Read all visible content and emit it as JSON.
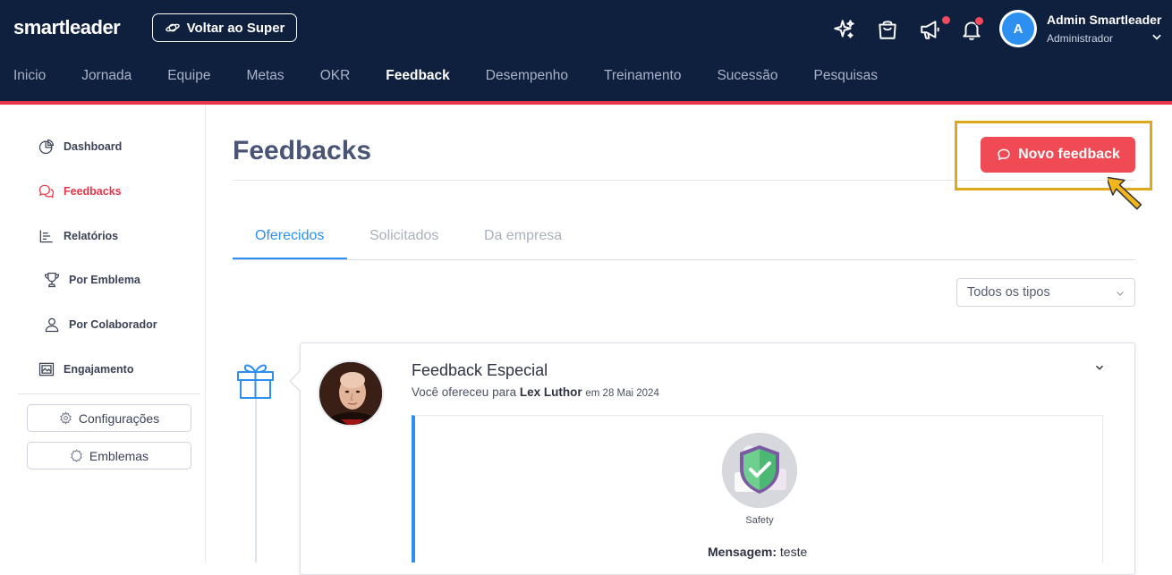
{
  "header": {
    "logo": "smartleader",
    "back_button": "Voltar ao Super",
    "user_initial": "A",
    "user_name": "Admin Smartleader",
    "user_role": "Administrador"
  },
  "nav": [
    "Inicio",
    "Jornada",
    "Equipe",
    "Metas",
    "OKR",
    "Feedback",
    "Desempenho",
    "Treinamento",
    "Sucessão",
    "Pesquisas"
  ],
  "nav_active": "Feedback",
  "sidebar": {
    "items": [
      {
        "label": "Dashboard",
        "icon": "pie-chart-icon"
      },
      {
        "label": "Feedbacks",
        "icon": "chat-bubbles-icon",
        "active": true
      },
      {
        "label": "Relatórios",
        "icon": "bar-list-icon"
      },
      {
        "label": "Por Emblema",
        "icon": "trophy-icon"
      },
      {
        "label": "Por Colaborador",
        "icon": "user-icon"
      },
      {
        "label": "Engajamento",
        "icon": "image-frame-icon"
      }
    ],
    "buttons": [
      {
        "label": "Configurações",
        "icon": "gear-icon"
      },
      {
        "label": "Emblemas",
        "icon": "badge-icon"
      }
    ]
  },
  "page": {
    "title": "Feedbacks",
    "new_button": "Novo feedback",
    "tabs": [
      "Oferecidos",
      "Solicitados",
      "Da empresa"
    ],
    "active_tab": "Oferecidos",
    "filter_value": "Todos os tipos"
  },
  "feedback": {
    "title": "Feedback Especial",
    "sub_prefix": "Você ofereceu para",
    "recipient": "Lex Luthor",
    "date": "em 28 Mai 2024",
    "badge_name": "Safety",
    "message_label": "Mensagem:",
    "message": "teste"
  },
  "colors": {
    "header_bg": "#0f1f3e",
    "accent_red": "#f04a55",
    "accent_blue": "#2d8ff0",
    "highlight": "#e0a81c"
  }
}
